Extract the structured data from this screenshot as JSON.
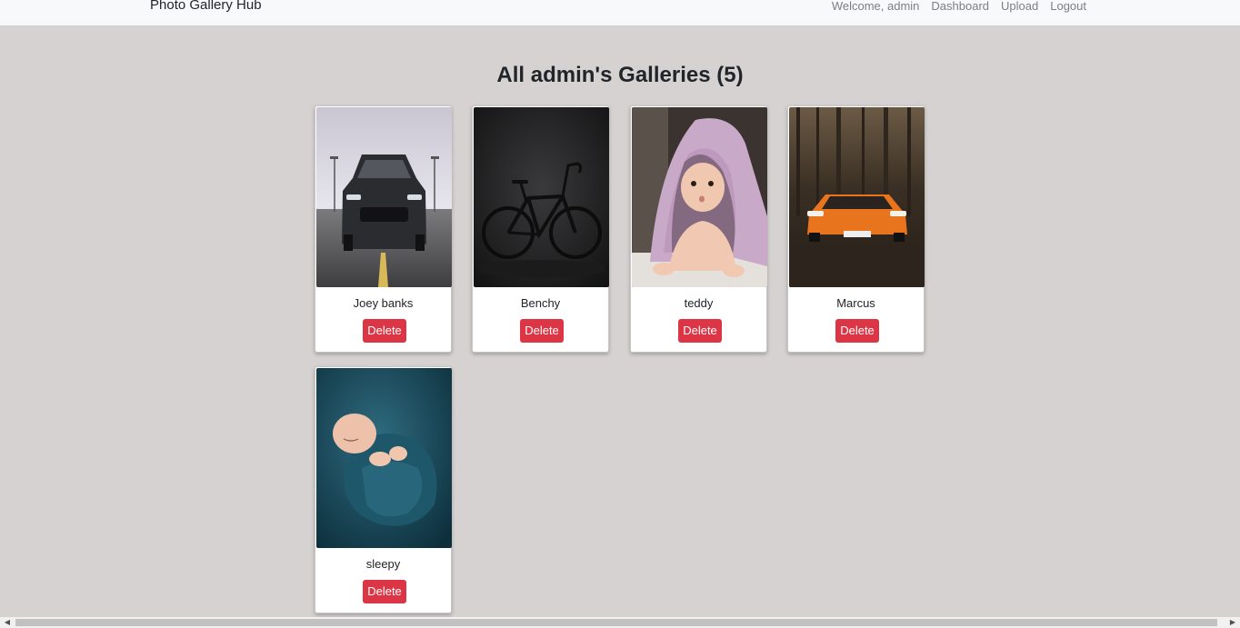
{
  "navbar": {
    "brand": "Photo Gallery Hub",
    "welcome": "Welcome, admin",
    "links": [
      "Dashboard",
      "Upload",
      "Logout"
    ]
  },
  "page": {
    "title": "All admin's Galleries (5)"
  },
  "galleries": [
    {
      "name": "Joey banks",
      "delete_label": "Delete",
      "image": "black-mustang-car"
    },
    {
      "name": "Benchy",
      "delete_label": "Delete",
      "image": "black-road-bike"
    },
    {
      "name": "teddy",
      "delete_label": "Delete",
      "image": "baby-under-blanket"
    },
    {
      "name": "Marcus",
      "delete_label": "Delete",
      "image": "orange-lamborghini-in-forest"
    },
    {
      "name": "sleepy",
      "delete_label": "Delete",
      "image": "sleeping-newborn-in-teal-wrap"
    }
  ],
  "colors": {
    "background": "#d6d2d2",
    "navbar": "#f8f9fa",
    "danger": "#dc3545"
  }
}
